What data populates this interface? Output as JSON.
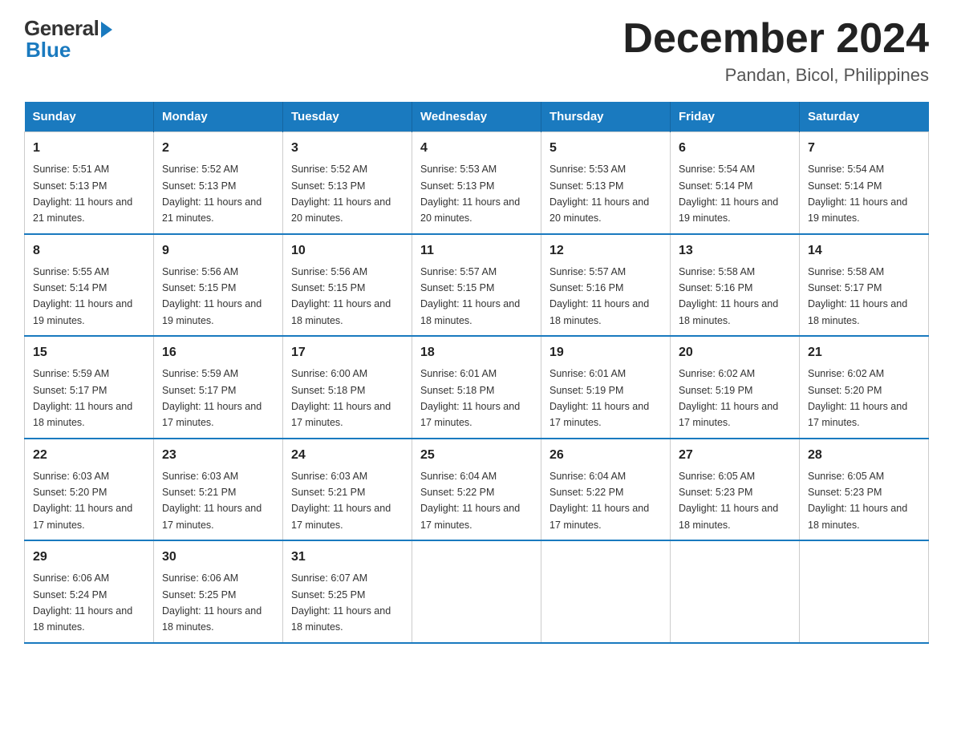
{
  "logo": {
    "general": "General",
    "blue": "Blue"
  },
  "title": "December 2024",
  "subtitle": "Pandan, Bicol, Philippines",
  "days": [
    "Sunday",
    "Monday",
    "Tuesday",
    "Wednesday",
    "Thursday",
    "Friday",
    "Saturday"
  ],
  "weeks": [
    [
      {
        "num": "1",
        "sunrise": "5:51 AM",
        "sunset": "5:13 PM",
        "daylight": "11 hours and 21 minutes."
      },
      {
        "num": "2",
        "sunrise": "5:52 AM",
        "sunset": "5:13 PM",
        "daylight": "11 hours and 21 minutes."
      },
      {
        "num": "3",
        "sunrise": "5:52 AM",
        "sunset": "5:13 PM",
        "daylight": "11 hours and 20 minutes."
      },
      {
        "num": "4",
        "sunrise": "5:53 AM",
        "sunset": "5:13 PM",
        "daylight": "11 hours and 20 minutes."
      },
      {
        "num": "5",
        "sunrise": "5:53 AM",
        "sunset": "5:13 PM",
        "daylight": "11 hours and 20 minutes."
      },
      {
        "num": "6",
        "sunrise": "5:54 AM",
        "sunset": "5:14 PM",
        "daylight": "11 hours and 19 minutes."
      },
      {
        "num": "7",
        "sunrise": "5:54 AM",
        "sunset": "5:14 PM",
        "daylight": "11 hours and 19 minutes."
      }
    ],
    [
      {
        "num": "8",
        "sunrise": "5:55 AM",
        "sunset": "5:14 PM",
        "daylight": "11 hours and 19 minutes."
      },
      {
        "num": "9",
        "sunrise": "5:56 AM",
        "sunset": "5:15 PM",
        "daylight": "11 hours and 19 minutes."
      },
      {
        "num": "10",
        "sunrise": "5:56 AM",
        "sunset": "5:15 PM",
        "daylight": "11 hours and 18 minutes."
      },
      {
        "num": "11",
        "sunrise": "5:57 AM",
        "sunset": "5:15 PM",
        "daylight": "11 hours and 18 minutes."
      },
      {
        "num": "12",
        "sunrise": "5:57 AM",
        "sunset": "5:16 PM",
        "daylight": "11 hours and 18 minutes."
      },
      {
        "num": "13",
        "sunrise": "5:58 AM",
        "sunset": "5:16 PM",
        "daylight": "11 hours and 18 minutes."
      },
      {
        "num": "14",
        "sunrise": "5:58 AM",
        "sunset": "5:17 PM",
        "daylight": "11 hours and 18 minutes."
      }
    ],
    [
      {
        "num": "15",
        "sunrise": "5:59 AM",
        "sunset": "5:17 PM",
        "daylight": "11 hours and 18 minutes."
      },
      {
        "num": "16",
        "sunrise": "5:59 AM",
        "sunset": "5:17 PM",
        "daylight": "11 hours and 17 minutes."
      },
      {
        "num": "17",
        "sunrise": "6:00 AM",
        "sunset": "5:18 PM",
        "daylight": "11 hours and 17 minutes."
      },
      {
        "num": "18",
        "sunrise": "6:01 AM",
        "sunset": "5:18 PM",
        "daylight": "11 hours and 17 minutes."
      },
      {
        "num": "19",
        "sunrise": "6:01 AM",
        "sunset": "5:19 PM",
        "daylight": "11 hours and 17 minutes."
      },
      {
        "num": "20",
        "sunrise": "6:02 AM",
        "sunset": "5:19 PM",
        "daylight": "11 hours and 17 minutes."
      },
      {
        "num": "21",
        "sunrise": "6:02 AM",
        "sunset": "5:20 PM",
        "daylight": "11 hours and 17 minutes."
      }
    ],
    [
      {
        "num": "22",
        "sunrise": "6:03 AM",
        "sunset": "5:20 PM",
        "daylight": "11 hours and 17 minutes."
      },
      {
        "num": "23",
        "sunrise": "6:03 AM",
        "sunset": "5:21 PM",
        "daylight": "11 hours and 17 minutes."
      },
      {
        "num": "24",
        "sunrise": "6:03 AM",
        "sunset": "5:21 PM",
        "daylight": "11 hours and 17 minutes."
      },
      {
        "num": "25",
        "sunrise": "6:04 AM",
        "sunset": "5:22 PM",
        "daylight": "11 hours and 17 minutes."
      },
      {
        "num": "26",
        "sunrise": "6:04 AM",
        "sunset": "5:22 PM",
        "daylight": "11 hours and 17 minutes."
      },
      {
        "num": "27",
        "sunrise": "6:05 AM",
        "sunset": "5:23 PM",
        "daylight": "11 hours and 18 minutes."
      },
      {
        "num": "28",
        "sunrise": "6:05 AM",
        "sunset": "5:23 PM",
        "daylight": "11 hours and 18 minutes."
      }
    ],
    [
      {
        "num": "29",
        "sunrise": "6:06 AM",
        "sunset": "5:24 PM",
        "daylight": "11 hours and 18 minutes."
      },
      {
        "num": "30",
        "sunrise": "6:06 AM",
        "sunset": "5:25 PM",
        "daylight": "11 hours and 18 minutes."
      },
      {
        "num": "31",
        "sunrise": "6:07 AM",
        "sunset": "5:25 PM",
        "daylight": "11 hours and 18 minutes."
      },
      null,
      null,
      null,
      null
    ]
  ]
}
